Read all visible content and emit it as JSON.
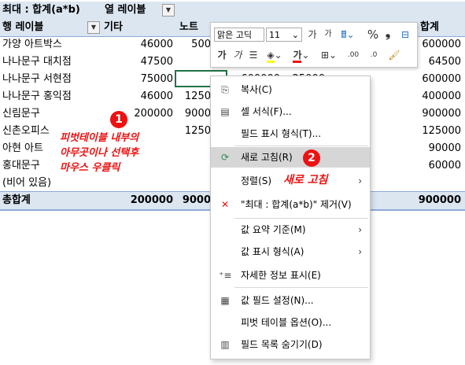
{
  "pivot": {
    "title_row": {
      "label": "최대 : 합계(a*b)",
      "col_label": "열 레이블"
    },
    "header": {
      "row_label": "행 레이블",
      "col1": "기타",
      "col2": "노트",
      "total": "합계"
    },
    "rows": [
      {
        "name": "가양 아트박스",
        "v1": "46000",
        "v2": "500",
        "total": "600000"
      },
      {
        "name": "나나문구 대치점",
        "v1": "47500",
        "v2": "",
        "total": "64500"
      },
      {
        "name": "나나문구 서현점",
        "v1": "75000",
        "v2": "",
        "v3": "600000",
        "v4": "25000",
        "total": "600000"
      },
      {
        "name": "나나문구 홍익점",
        "v1": "46000",
        "v2": "1250",
        "total": "400000"
      },
      {
        "name": "신림문구",
        "v1": "200000",
        "v2": "9000",
        "total": "900000"
      },
      {
        "name": "신촌오피스",
        "v1": "",
        "v2": "1250",
        "total": "125000"
      },
      {
        "name": "아현 아트",
        "v1": "",
        "v2": "",
        "total": "90000"
      },
      {
        "name": "홍대문구",
        "v1": "",
        "v2": "",
        "total": "60000"
      },
      {
        "name": "(비어 있음)",
        "v1": "",
        "v2": "",
        "total": ""
      }
    ],
    "grand_total": {
      "label": "총합계",
      "v1": "200000",
      "v2": "9000",
      "total": "900000"
    }
  },
  "annotation": {
    "badge1": "1",
    "text1_line1": "피벗테이블 내부의",
    "text1_line2": "아무곳이나 선택후",
    "text1_line3": "마우스 우클릭",
    "badge2": "2",
    "text2": "새로 고침"
  },
  "mini_toolbar": {
    "font_name": "맑은 고딕",
    "font_size": "11",
    "grow_font": "가",
    "shrink_font": "가",
    "percent": "%",
    "comma": "❟",
    "bold": "가",
    "italic": "가",
    "font_color_label": "가",
    "inc_decimal": ".00",
    "dec_decimal": ".0"
  },
  "context_menu": {
    "items": [
      {
        "label": "복사(C)",
        "icon": "copy-icon"
      },
      {
        "label": "셀 서식(F)...",
        "icon": "format-cells-icon"
      },
      {
        "label": "필드 표시 형식(T)...",
        "icon": ""
      },
      {
        "label": "새로 고침(R)",
        "icon": "refresh-icon"
      },
      {
        "label": "정렬(S)",
        "icon": "",
        "submenu": "›"
      },
      {
        "label": "\"최대 : 합계(a*b)\" 제거(V)",
        "icon": "remove-x-icon"
      },
      {
        "label": "값 요약 기준(M)",
        "icon": "",
        "submenu": "›"
      },
      {
        "label": "값 표시 형식(A)",
        "icon": "",
        "submenu": "›"
      },
      {
        "label": "자세한 정보 표시(E)",
        "icon": "show-details-icon"
      },
      {
        "label": "값 필드 설정(N)...",
        "icon": "value-field-settings-icon"
      },
      {
        "label": "피벗 테이블 옵션(O)...",
        "icon": ""
      },
      {
        "label": "필드 목록 숨기기(D)",
        "icon": "field-list-icon"
      }
    ]
  },
  "colors": {
    "accent_red": "#e11111",
    "header_band": "#dce6f1",
    "selection_green": "#217346"
  }
}
